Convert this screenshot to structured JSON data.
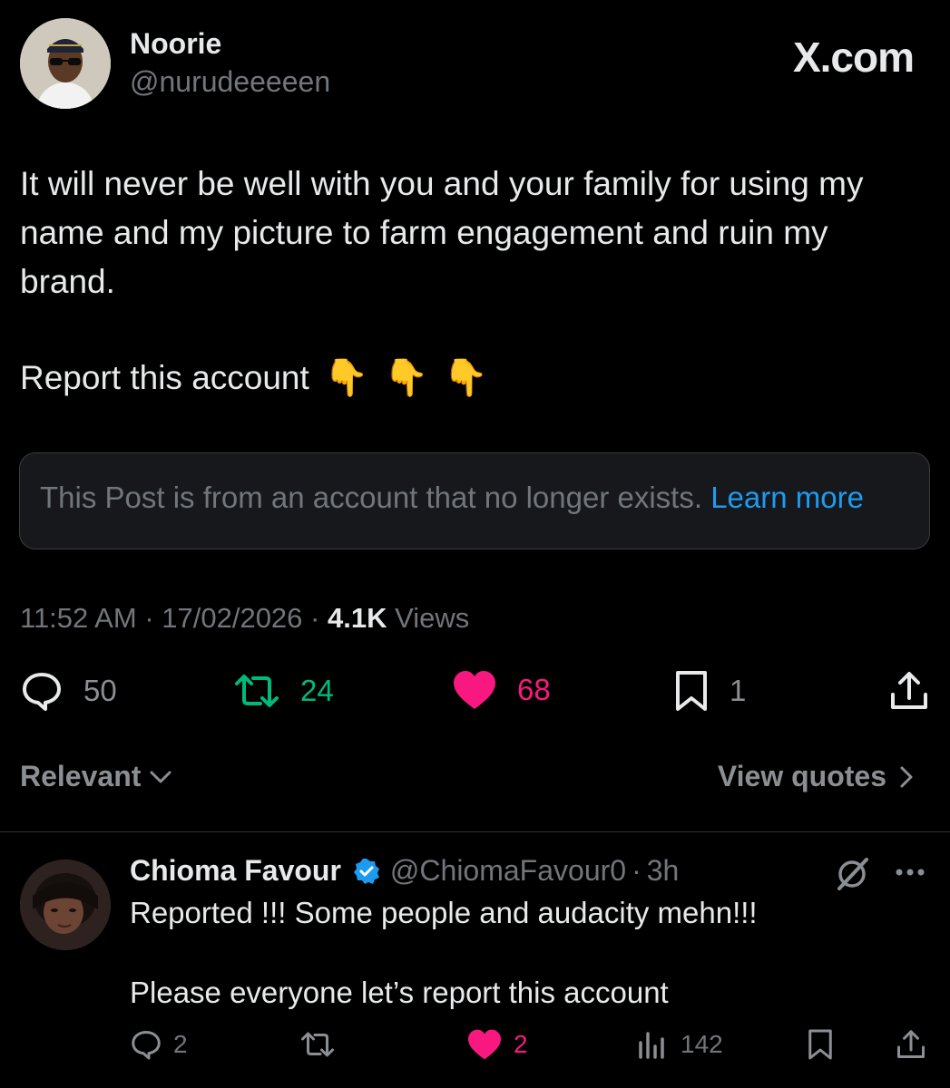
{
  "post": {
    "author_name": "Noorie",
    "author_handle": "@nurudeeeeen",
    "site_label": "X.com",
    "text_line1": "It will never be well with you and your family for using my name and my picture to farm engagement and ruin my brand.",
    "text_line2": "Report this account",
    "emoji": "👇",
    "notice_text": "This Post is from an account that no longer exists.",
    "notice_link": "Learn more",
    "time": "11:52 AM",
    "date": "17/02/2026",
    "views_count": "4.1K",
    "views_label": "Views",
    "separator": "·",
    "replies": "50",
    "reposts": "24",
    "likes": "68",
    "bookmarks": "1"
  },
  "controls": {
    "sort_label": "Relevant",
    "view_quotes_label": "View quotes"
  },
  "reply": {
    "author_name": "Chioma Favour",
    "author_handle": "@ChiomaFavour0",
    "age": "3h",
    "separator": "·",
    "line1": "Reported !!! Some people and audacity mehn!!!",
    "line2": "Please everyone let’s report this account",
    "replies": "2",
    "likes": "2",
    "views": "142"
  },
  "colors": {
    "background": "#000000",
    "text_primary": "#e7e9ea",
    "text_secondary": "#71767b",
    "link": "#1d9bf0",
    "repost_green": "#00ba7c",
    "like_pink": "#f91880",
    "verified_blue": "#1d9bf0"
  },
  "icons": {
    "reply": "speech-bubble-icon",
    "repost": "repost-arrows-icon",
    "like": "heart-icon",
    "bookmark": "bookmark-icon",
    "share": "share-icon",
    "views": "bar-chart-icon",
    "grok": "grok-icon",
    "more": "ellipsis-icon",
    "verified": "verified-badge-icon"
  }
}
